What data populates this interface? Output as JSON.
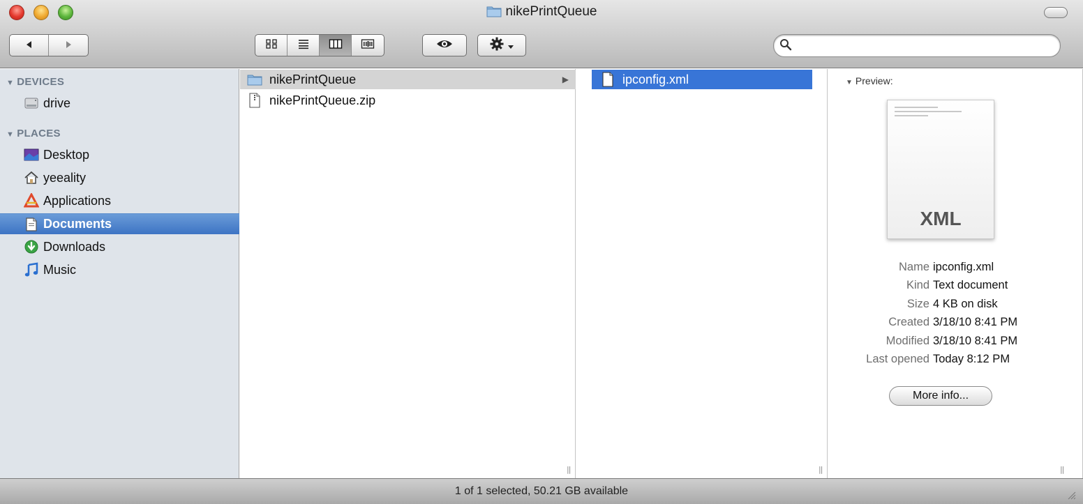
{
  "window": {
    "title": "nikePrintQueue"
  },
  "toolbar": {
    "back_icon": "left-triangle-icon",
    "forward_icon": "right-triangle-icon",
    "view_modes": [
      "icon-view",
      "list-view",
      "column-view",
      "coverflow-view"
    ],
    "active_view": "column-view",
    "quicklook_icon": "eye-icon",
    "action_icon": "gear-icon",
    "search_placeholder": ""
  },
  "sidebar": {
    "sections": [
      {
        "heading": "DEVICES",
        "items": [
          {
            "label": "drive",
            "icon": "harddrive-icon"
          }
        ]
      },
      {
        "heading": "PLACES",
        "items": [
          {
            "label": "Desktop",
            "icon": "desktop-icon"
          },
          {
            "label": "yeeality",
            "icon": "home-icon"
          },
          {
            "label": "Applications",
            "icon": "applications-icon"
          },
          {
            "label": "Documents",
            "icon": "documents-icon",
            "selected": true
          },
          {
            "label": "Downloads",
            "icon": "downloads-icon"
          },
          {
            "label": "Music",
            "icon": "music-icon"
          }
        ]
      }
    ]
  },
  "columns": {
    "col1": [
      {
        "name": "nikePrintQueue",
        "icon": "folder-icon",
        "has_children": true
      },
      {
        "name": "nikePrintQueue.zip",
        "icon": "zip-file-icon"
      }
    ],
    "col2": [
      {
        "name": "ipconfig.xml",
        "icon": "document-icon",
        "selected": true
      }
    ]
  },
  "preview": {
    "label": "Preview:",
    "doc_ext": "XML",
    "info": [
      {
        "key": "Name",
        "value": "ipconfig.xml"
      },
      {
        "key": "Kind",
        "value": "Text document"
      },
      {
        "key": "Size",
        "value": "4 KB on disk"
      },
      {
        "key": "Created",
        "value": "3/18/10 8:41 PM"
      },
      {
        "key": "Modified",
        "value": "3/18/10 8:41 PM"
      },
      {
        "key": "Last opened",
        "value": "Today 8:12 PM"
      }
    ],
    "more_info_label": "More info..."
  },
  "status": {
    "text": "1 of 1 selected, 50.21 GB available"
  },
  "colors": {
    "selection": "#3875d7",
    "sidebar_bg": "#dfe4ea",
    "sidebar_heading": "#6e7b8a"
  }
}
